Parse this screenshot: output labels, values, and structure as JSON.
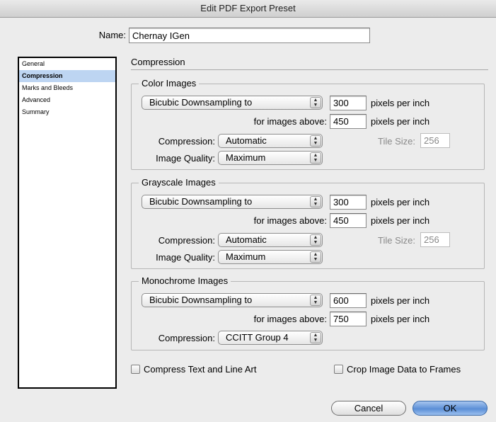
{
  "window": {
    "title": "Edit PDF Export Preset"
  },
  "name_field": {
    "label": "Name:",
    "value": "Chernay IGen"
  },
  "sidebar": {
    "items": [
      {
        "label": "General"
      },
      {
        "label": "Compression"
      },
      {
        "label": "Marks and Bleeds"
      },
      {
        "label": "Advanced"
      },
      {
        "label": "Summary"
      }
    ],
    "selected": "Compression"
  },
  "panel_title": "Compression",
  "color_images": {
    "title": "Color Images",
    "downsample_method": "Bicubic Downsampling to",
    "ppi": "300",
    "ppi_unit": "pixels per inch",
    "above_label": "for images above:",
    "above_value": "450",
    "above_unit": "pixels per inch",
    "compression_label": "Compression:",
    "compression_value": "Automatic",
    "tile_label": "Tile Size:",
    "tile_value": "256",
    "quality_label": "Image Quality:",
    "quality_value": "Maximum"
  },
  "grayscale_images": {
    "title": "Grayscale Images",
    "downsample_method": "Bicubic Downsampling to",
    "ppi": "300",
    "ppi_unit": "pixels per inch",
    "above_label": "for images above:",
    "above_value": "450",
    "above_unit": "pixels per inch",
    "compression_label": "Compression:",
    "compression_value": "Automatic",
    "tile_label": "Tile Size:",
    "tile_value": "256",
    "quality_label": "Image Quality:",
    "quality_value": "Maximum"
  },
  "monochrome_images": {
    "title": "Monochrome Images",
    "downsample_method": "Bicubic Downsampling to",
    "ppi": "600",
    "ppi_unit": "pixels per inch",
    "above_label": "for images above:",
    "above_value": "750",
    "above_unit": "pixels per inch",
    "compression_label": "Compression:",
    "compression_value": "CCITT Group 4"
  },
  "options": {
    "compress_text": {
      "label": "Compress Text and Line Art",
      "checked": false
    },
    "crop_image": {
      "label": "Crop Image Data to Frames",
      "checked": false
    }
  },
  "buttons": {
    "cancel": "Cancel",
    "ok": "OK"
  },
  "colors": {
    "selection": "#bdd5f2",
    "default_button": "#5b8fd6"
  }
}
